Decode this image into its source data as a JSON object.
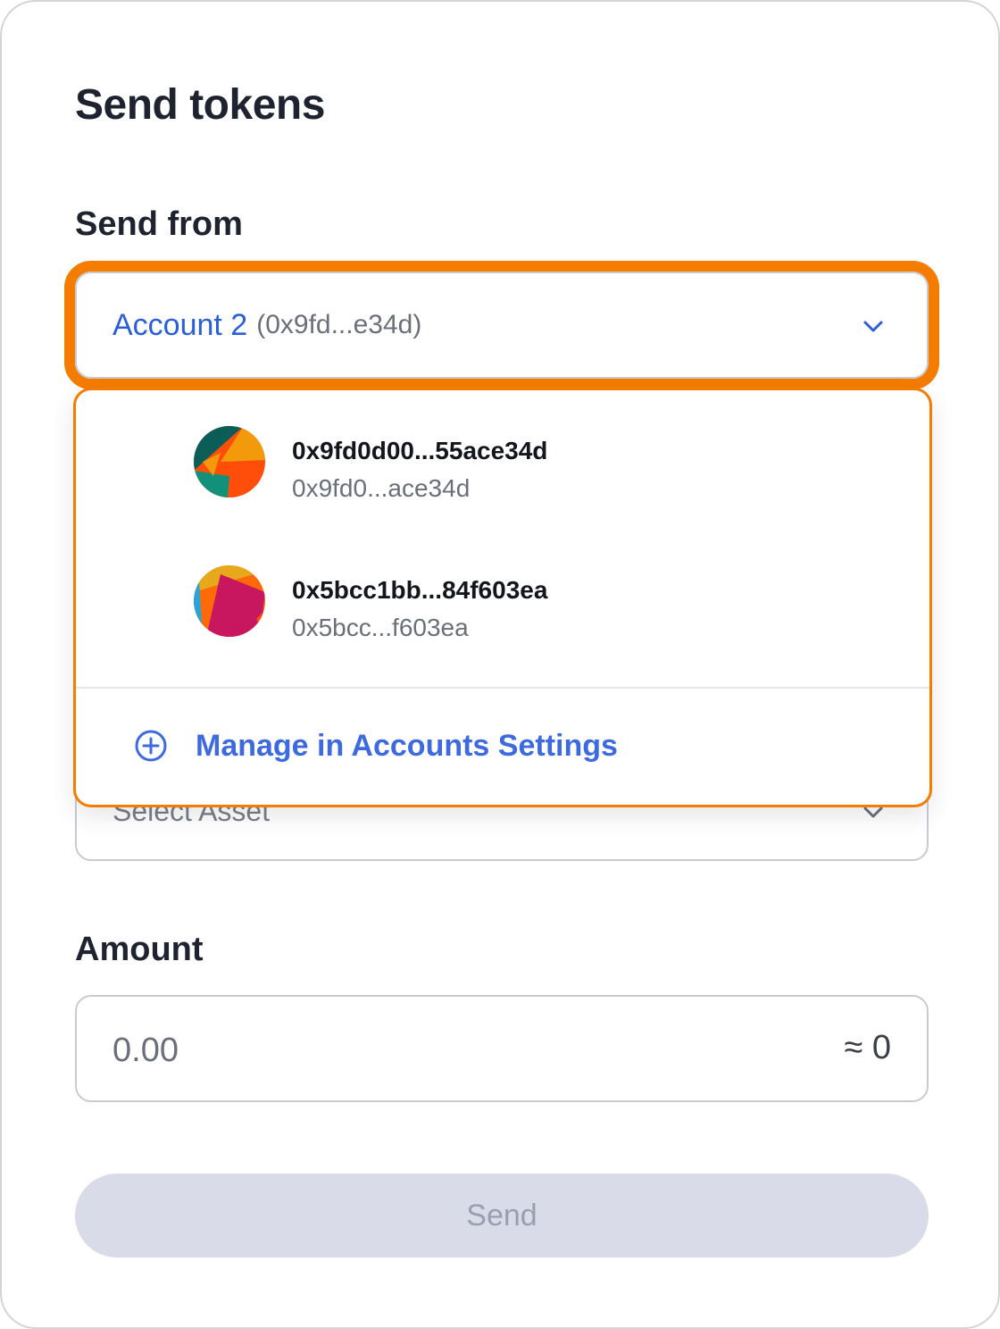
{
  "title": "Send tokens",
  "send_from": {
    "label": "Send from",
    "selected_account_name": "Account 2",
    "selected_account_address": "(0x9fd...e34d)",
    "chevron_icon": "chevron-down-icon"
  },
  "dropdown": {
    "options": [
      {
        "title": "0x9fd0d00...55ace34d",
        "subtitle": "0x9fd0...ace34d",
        "avatar_colors": [
          "#0b5e58",
          "#f29a0c",
          "#ff4d0a",
          "#11907a"
        ]
      },
      {
        "title": "0x5bcc1bb...84f603ea",
        "subtitle": "0x5bcc...f603ea",
        "avatar_colors": [
          "#ff6a08",
          "#c8175f",
          "#2aa3d6",
          "#e8a81c"
        ]
      }
    ],
    "manage_label": "Manage in Accounts Settings",
    "manage_icon": "plus-circle-icon"
  },
  "asset": {
    "placeholder": "Select Asset"
  },
  "amount": {
    "label": "Amount",
    "placeholder": "0.00",
    "fiat_estimate": "≈ 0"
  },
  "send_button": {
    "label": "Send",
    "disabled": true
  },
  "colors": {
    "accent": "#f47c00",
    "link": "#3e6ae0",
    "button_disabled_bg": "#d9dbe8"
  }
}
